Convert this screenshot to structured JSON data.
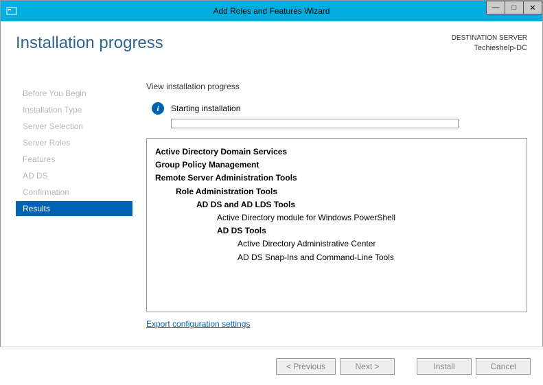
{
  "window": {
    "title": "Add Roles and Features Wizard"
  },
  "header": {
    "page_title": "Installation progress",
    "dest_label": "DESTINATION SERVER",
    "dest_server": "Techieshelp-DC"
  },
  "nav": {
    "items": [
      {
        "label": "Before You Begin",
        "active": false
      },
      {
        "label": "Installation Type",
        "active": false
      },
      {
        "label": "Server Selection",
        "active": false
      },
      {
        "label": "Server Roles",
        "active": false
      },
      {
        "label": "Features",
        "active": false
      },
      {
        "label": "AD DS",
        "active": false
      },
      {
        "label": "Confirmation",
        "active": false
      },
      {
        "label": "Results",
        "active": true
      }
    ]
  },
  "main": {
    "view_label": "View installation progress",
    "status_text": "Starting installation",
    "features": [
      {
        "text": "Active Directory Domain Services",
        "cls": "l0"
      },
      {
        "text": "Group Policy Management",
        "cls": "l0"
      },
      {
        "text": "Remote Server Administration Tools",
        "cls": "l0"
      },
      {
        "text": "Role Administration Tools",
        "cls": "l1"
      },
      {
        "text": "AD DS and AD LDS Tools",
        "cls": "l2"
      },
      {
        "text": "Active Directory module for Windows PowerShell",
        "cls": "l3"
      },
      {
        "text": "AD DS Tools",
        "cls": "l3b"
      },
      {
        "text": "Active Directory Administrative Center",
        "cls": "l4"
      },
      {
        "text": "AD DS Snap-Ins and Command-Line Tools",
        "cls": "l4"
      }
    ],
    "export_link": "Export configuration settings"
  },
  "footer": {
    "previous": "< Previous",
    "next": "Next >",
    "install": "Install",
    "cancel": "Cancel"
  }
}
